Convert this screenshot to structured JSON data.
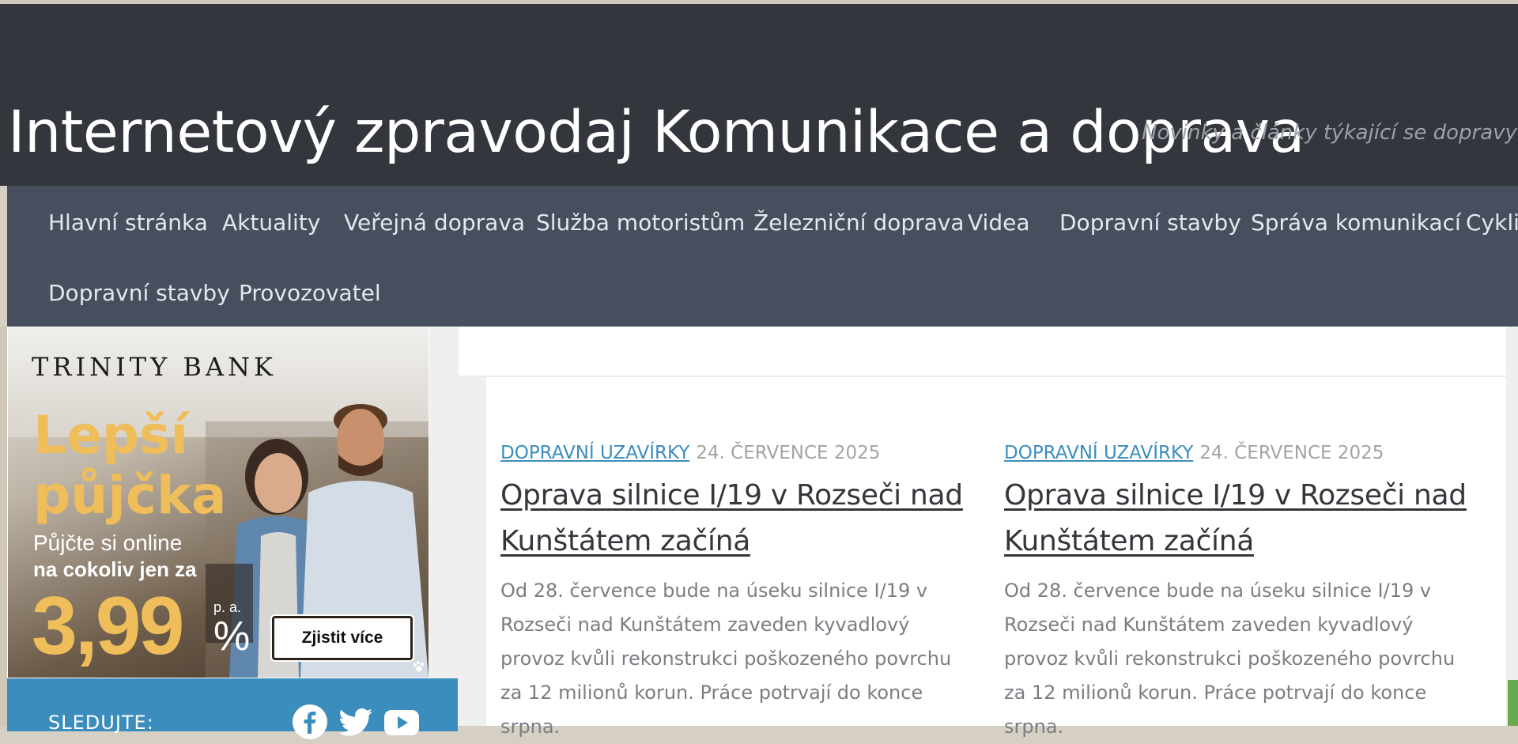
{
  "site": {
    "title": "Internetový zpravodaj Komunikace a doprava",
    "tagline": "Novinky a články týkající se dopravy ČR"
  },
  "nav": {
    "items": [
      "Hlavní stránka",
      "Aktuality",
      "Veřejná doprava",
      "Služba motoristům",
      "Železniční doprava",
      "Videa",
      "Dopravní stavby",
      "Správa komunikací",
      "Cyklis",
      "Dopravní stavby",
      "Provozovatel"
    ]
  },
  "ad": {
    "bank": "TRINITY BANK",
    "headline": "Lepší půjčka",
    "sub1": "Půjčte si online",
    "sub2": "na cokoliv jen za",
    "rate": "3,99",
    "pa": "p. a.",
    "percent": "%",
    "cta": "Zjistit více"
  },
  "follow": {
    "label": "SLEDUJTE:",
    "icons": [
      "facebook-icon",
      "twitter-icon",
      "youtube-icon"
    ],
    "color": "#3b8dbd"
  },
  "posts": [
    {
      "category": "DOPRAVNÍ UZAVÍRKY",
      "date": "24. ČERVENCE 2025",
      "title": "Oprava silnice I/19 v Rozseči nad Kunštátem začíná",
      "excerpt": "Od 28. července bude na úseku silnice I/19 v Rozseči nad Kunštátem zaveden kyvadlový provoz kvůli rekonstrukci poškozeného povrchu za 12 milionů korun. Práce potrvají do konce srpna."
    },
    {
      "category": "DOPRAVNÍ UZAVÍRKY",
      "date": "24. ČERVENCE 2025",
      "title": "Oprava silnice I/19 v Rozseči nad Kunštátem začíná",
      "excerpt": "Od 28. července bude na úseku silnice I/19 v Rozseči nad Kunštátem zaveden kyvadlový provoz kvůli rekonstrukci poškozeného povrchu za 12 milionů korun. Práce potrvají do konce srpna."
    }
  ],
  "colors": {
    "header_bg": "#34363d",
    "nav_bg": "#474f5e",
    "accent": "#3b8dbd",
    "ad_gold": "#efbd5a"
  }
}
